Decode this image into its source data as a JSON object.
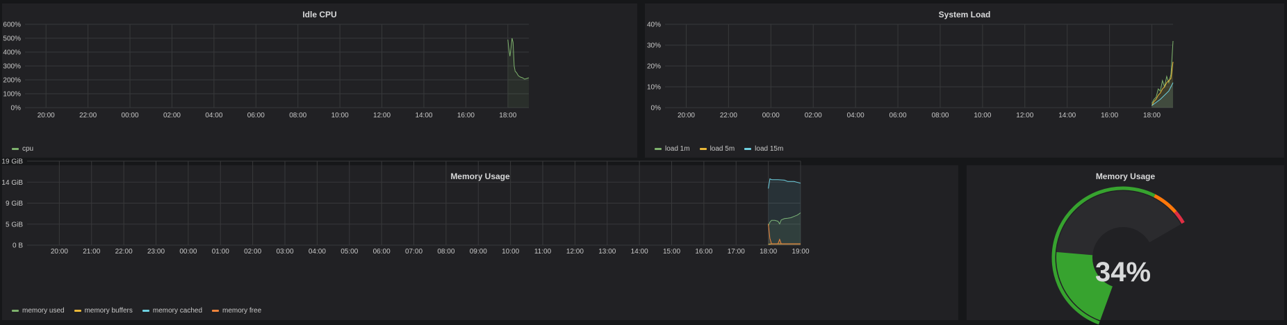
{
  "colors": {
    "background": "#161719",
    "panel": "#212124",
    "grid": "#38393b",
    "green": "#7eb26d",
    "yellow": "#eab839",
    "cyan": "#6ed0e0",
    "orange": "#ef843c",
    "gauge_green": "#37a32f",
    "gauge_orange": "#ff780a",
    "gauge_red": "#e02f44"
  },
  "panels": {
    "idle_cpu": {
      "title": "Idle CPU"
    },
    "system_load": {
      "title": "System Load"
    },
    "memory_usage": {
      "title": "Memory Usage"
    },
    "memory_gauge": {
      "title": "Memory Usage",
      "value": 34,
      "value_text": "34%",
      "thresholds": [
        85,
        95
      ],
      "min": 0,
      "max": 100
    }
  },
  "chart_data": [
    {
      "id": "idle_cpu",
      "type": "area",
      "title": "Idle CPU",
      "y_ticks": [
        "0%",
        "100%",
        "200%",
        "300%",
        "400%",
        "500%",
        "600%"
      ],
      "ylim": [
        0,
        600
      ],
      "x_ticks": [
        "20:00",
        "22:00",
        "00:00",
        "02:00",
        "04:00",
        "06:00",
        "08:00",
        "10:00",
        "12:00",
        "14:00",
        "16:00",
        "18:00"
      ],
      "x_tick_hours": [
        20,
        22,
        24,
        26,
        28,
        30,
        32,
        34,
        36,
        38,
        40,
        42
      ],
      "xlim": [
        19.0,
        43.0
      ],
      "grid": true,
      "legend_position": "bottom-left",
      "series": [
        {
          "name": "cpu",
          "color": "#7eb26d",
          "x": [
            42.0,
            42.05,
            42.1,
            42.15,
            42.2,
            42.25,
            42.3,
            42.35,
            42.4,
            42.5,
            42.6,
            42.7,
            42.8,
            42.9,
            43.0
          ],
          "y": [
            490,
            420,
            370,
            430,
            500,
            470,
            300,
            260,
            255,
            230,
            220,
            215,
            205,
            210,
            215
          ]
        }
      ]
    },
    {
      "id": "system_load",
      "type": "area",
      "title": "System Load",
      "y_ticks": [
        "0%",
        "10%",
        "20%",
        "30%",
        "40%"
      ],
      "ylim": [
        0,
        40
      ],
      "x_ticks": [
        "20:00",
        "22:00",
        "00:00",
        "02:00",
        "04:00",
        "06:00",
        "08:00",
        "10:00",
        "12:00",
        "14:00",
        "16:00",
        "18:00"
      ],
      "x_tick_hours": [
        20,
        22,
        24,
        26,
        28,
        30,
        32,
        34,
        36,
        38,
        40,
        42
      ],
      "xlim": [
        19.0,
        43.0
      ],
      "grid": true,
      "legend_position": "bottom-left",
      "series": [
        {
          "name": "load 1m",
          "color": "#7eb26d",
          "x": [
            42.0,
            42.1,
            42.2,
            42.3,
            42.4,
            42.5,
            42.6,
            42.7,
            42.8,
            42.85,
            42.9,
            42.95,
            43.0
          ],
          "y": [
            2,
            4,
            5,
            9,
            8,
            13,
            10,
            15,
            12,
            14,
            16,
            24,
            32
          ]
        },
        {
          "name": "load 5m",
          "color": "#eab839",
          "x": [
            42.0,
            42.1,
            42.2,
            42.3,
            42.4,
            42.5,
            42.6,
            42.7,
            42.8,
            42.9,
            43.0
          ],
          "y": [
            1,
            3,
            4,
            6,
            7,
            9,
            10,
            12,
            13,
            14,
            22
          ]
        },
        {
          "name": "load 15m",
          "color": "#6ed0e0",
          "x": [
            42.0,
            42.2,
            42.4,
            42.6,
            42.8,
            43.0
          ],
          "y": [
            1,
            2.5,
            4,
            6,
            8,
            12
          ]
        }
      ]
    },
    {
      "id": "memory_usage",
      "type": "area",
      "title": "Memory Usage",
      "y_ticks": [
        "0 B",
        "5 GiB",
        "9 GiB",
        "14 GiB",
        "19 GiB"
      ],
      "ylim": [
        0,
        19
      ],
      "x_ticks": [
        "20:00",
        "21:00",
        "22:00",
        "23:00",
        "00:00",
        "01:00",
        "02:00",
        "03:00",
        "04:00",
        "05:00",
        "06:00",
        "07:00",
        "08:00",
        "09:00",
        "10:00",
        "11:00",
        "12:00",
        "13:00",
        "14:00",
        "15:00",
        "16:00",
        "17:00",
        "18:00",
        "19:00"
      ],
      "x_tick_hours": [
        20,
        21,
        22,
        23,
        24,
        25,
        26,
        27,
        28,
        29,
        30,
        31,
        32,
        33,
        34,
        35,
        36,
        37,
        38,
        39,
        40,
        41,
        42,
        43
      ],
      "xlim": [
        19.0,
        43.0
      ],
      "grid": true,
      "legend_position": "bottom-left",
      "series": [
        {
          "name": "memory used",
          "color": "#7eb26d",
          "x": [
            42.0,
            42.05,
            42.1,
            42.2,
            42.3,
            42.35,
            42.4,
            42.5,
            42.6,
            42.7,
            42.8,
            42.9,
            43.0
          ],
          "y": [
            4.3,
            5.2,
            5.6,
            5.6,
            5.4,
            4.8,
            5.7,
            6.0,
            6.1,
            6.2,
            6.5,
            6.8,
            7.3
          ]
        },
        {
          "name": "memory buffers",
          "color": "#eab839",
          "x": [
            42.0,
            42.1,
            42.3,
            42.5,
            43.0
          ],
          "y": [
            0.2,
            0.3,
            0.3,
            0.3,
            0.3
          ]
        },
        {
          "name": "memory cached",
          "color": "#6ed0e0",
          "x": [
            42.0,
            42.05,
            42.1,
            42.3,
            42.5,
            42.6,
            42.8,
            43.0
          ],
          "y": [
            12.8,
            15.0,
            14.8,
            14.8,
            14.7,
            14.4,
            14.4,
            14.0
          ]
        },
        {
          "name": "memory free",
          "color": "#ef843c",
          "x": [
            42.0,
            42.05,
            42.1,
            42.3,
            42.35,
            42.4,
            42.5,
            43.0
          ],
          "y": [
            4.8,
            1.5,
            0.3,
            0.3,
            1.3,
            0.3,
            0.3,
            0.3
          ]
        }
      ]
    }
  ]
}
